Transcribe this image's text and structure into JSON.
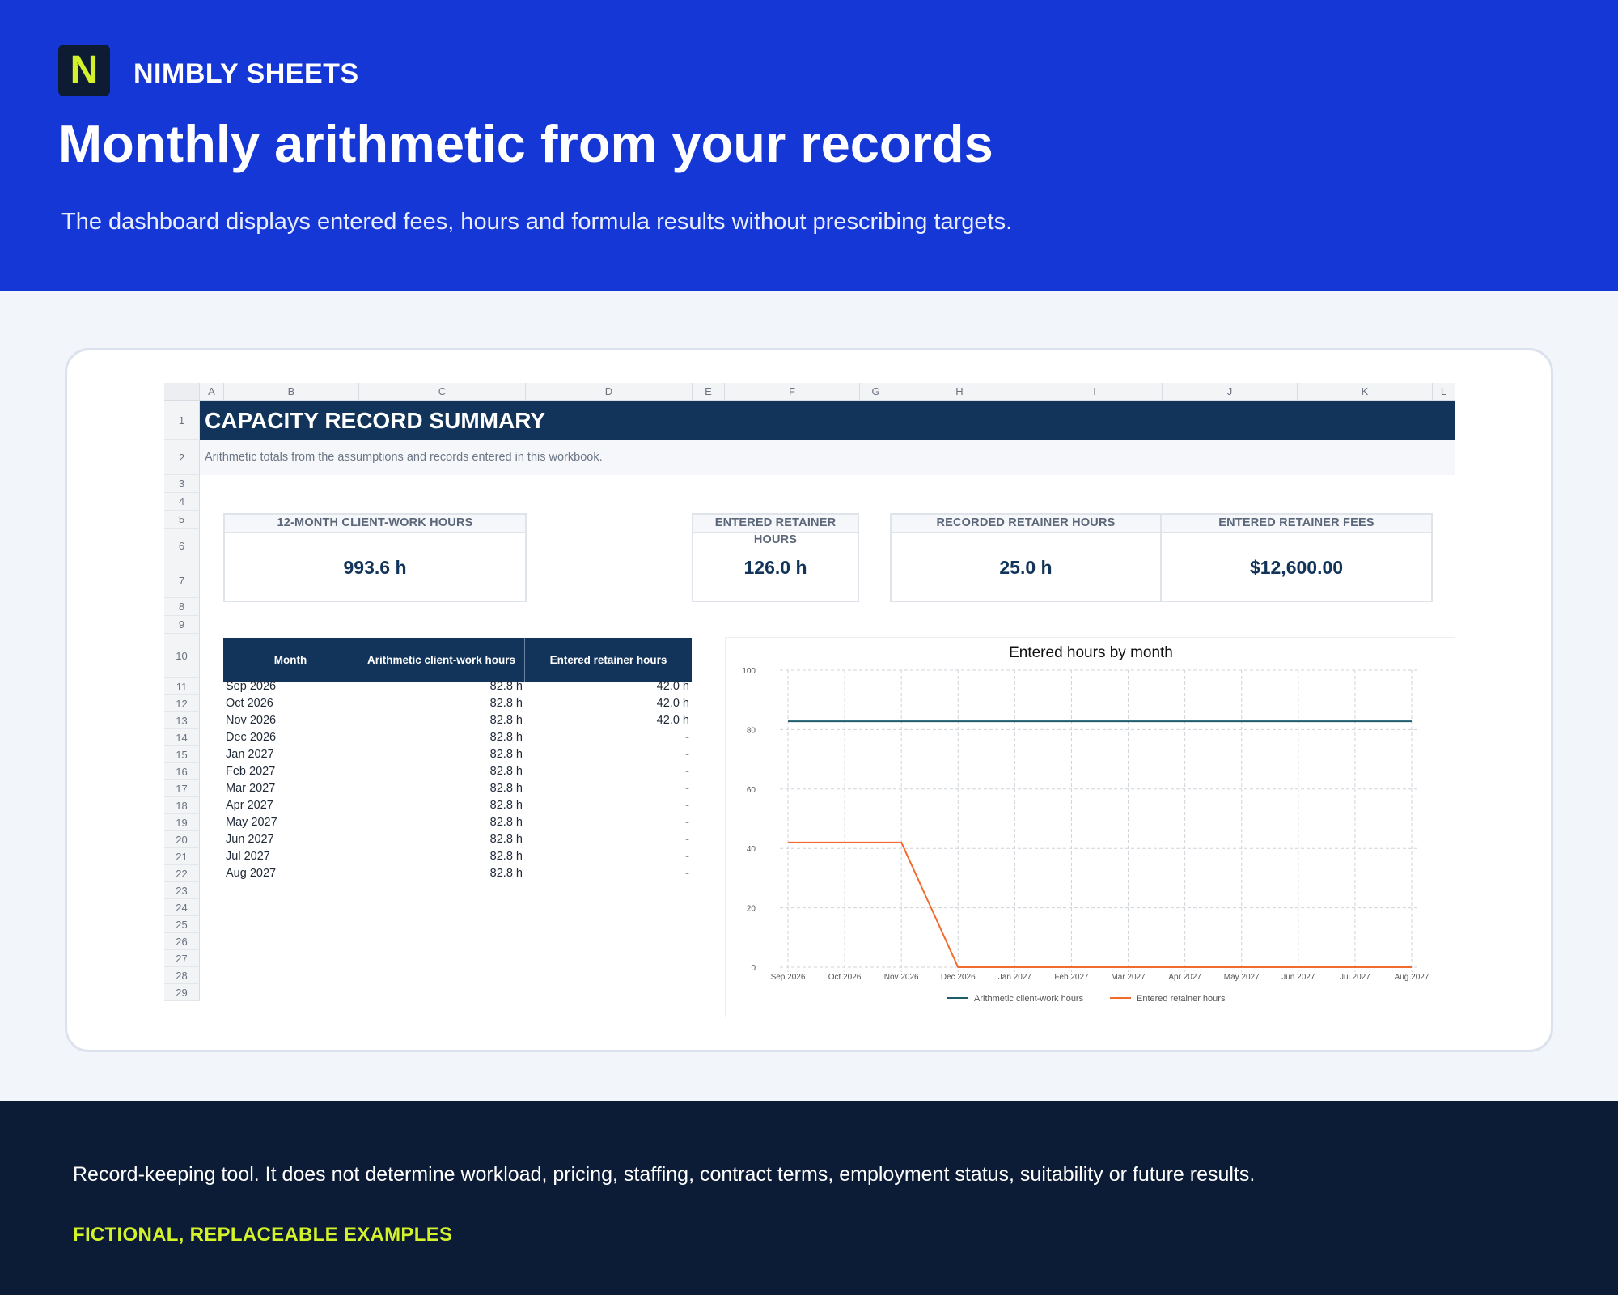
{
  "brand": {
    "logo_letter": "N",
    "name": "NIMBLY SHEETS"
  },
  "hero": {
    "title": "Monthly arithmetic from your records",
    "subtitle": "The dashboard displays entered fees, hours and formula results without prescribing targets."
  },
  "sheet": {
    "columns": [
      "A",
      "B",
      "C",
      "D",
      "E",
      "F",
      "G",
      "H",
      "I",
      "J",
      "K",
      "L"
    ],
    "rows": [
      "1",
      "2",
      "3",
      "4",
      "5",
      "6",
      "7",
      "8",
      "9",
      "10",
      "11",
      "12",
      "13",
      "14",
      "15",
      "16",
      "17",
      "18",
      "19",
      "20",
      "21",
      "22",
      "23",
      "24",
      "25",
      "26",
      "27",
      "28",
      "29"
    ],
    "title": "CAPACITY RECORD SUMMARY",
    "note": "Arithmetic totals from the assumptions and records entered in this workbook."
  },
  "kpis": [
    {
      "label": "12-MONTH CLIENT-WORK HOURS",
      "value": "993.6 h"
    },
    {
      "label": "ENTERED RETAINER HOURS",
      "value": "126.0 h"
    },
    {
      "label": "RECORDED RETAINER HOURS",
      "value": "25.0 h"
    },
    {
      "label": "ENTERED RETAINER FEES",
      "value": "$12,600.00"
    }
  ],
  "table": {
    "headers": [
      "Month",
      "Arithmetic client-work hours",
      "Entered retainer hours"
    ],
    "rows": [
      [
        "Sep 2026",
        "82.8 h",
        "42.0 h"
      ],
      [
        "Oct 2026",
        "82.8 h",
        "42.0 h"
      ],
      [
        "Nov 2026",
        "82.8 h",
        "42.0 h"
      ],
      [
        "Dec 2026",
        "82.8 h",
        "-"
      ],
      [
        "Jan 2027",
        "82.8 h",
        "-"
      ],
      [
        "Feb 2027",
        "82.8 h",
        "-"
      ],
      [
        "Mar 2027",
        "82.8 h",
        "-"
      ],
      [
        "Apr 2027",
        "82.8 h",
        "-"
      ],
      [
        "May 2027",
        "82.8 h",
        "-"
      ],
      [
        "Jun 2027",
        "82.8 h",
        "-"
      ],
      [
        "Jul 2027",
        "82.8 h",
        "-"
      ],
      [
        "Aug 2027",
        "82.8 h",
        "-"
      ]
    ]
  },
  "chart_data": {
    "type": "line",
    "title": "Entered hours by month",
    "categories": [
      "Sep 2026",
      "Oct 2026",
      "Nov 2026",
      "Dec 2026",
      "Jan 2027",
      "Feb 2027",
      "Mar 2027",
      "Apr 2027",
      "May 2027",
      "Jun 2027",
      "Jul 2027",
      "Aug 2027"
    ],
    "series": [
      {
        "name": "Arithmetic client-work hours",
        "color": "#1f5c6b",
        "values": [
          82.8,
          82.8,
          82.8,
          82.8,
          82.8,
          82.8,
          82.8,
          82.8,
          82.8,
          82.8,
          82.8,
          82.8
        ]
      },
      {
        "name": "Entered retainer hours",
        "color": "#f26b2d",
        "values": [
          42,
          42,
          42,
          0,
          0,
          0,
          0,
          0,
          0,
          0,
          0,
          0
        ]
      }
    ],
    "ylim": [
      0,
      100
    ],
    "yticks": [
      "0",
      "20",
      "40",
      "60",
      "80",
      "100"
    ],
    "grid": true,
    "legend": "bottom"
  },
  "footer": {
    "disclaimer": "Record-keeping tool. It does not determine workload, pricing, staffing, contract terms, employment status, suitability or future results.",
    "badge": "FICTIONAL, REPLACEABLE EXAMPLES"
  }
}
